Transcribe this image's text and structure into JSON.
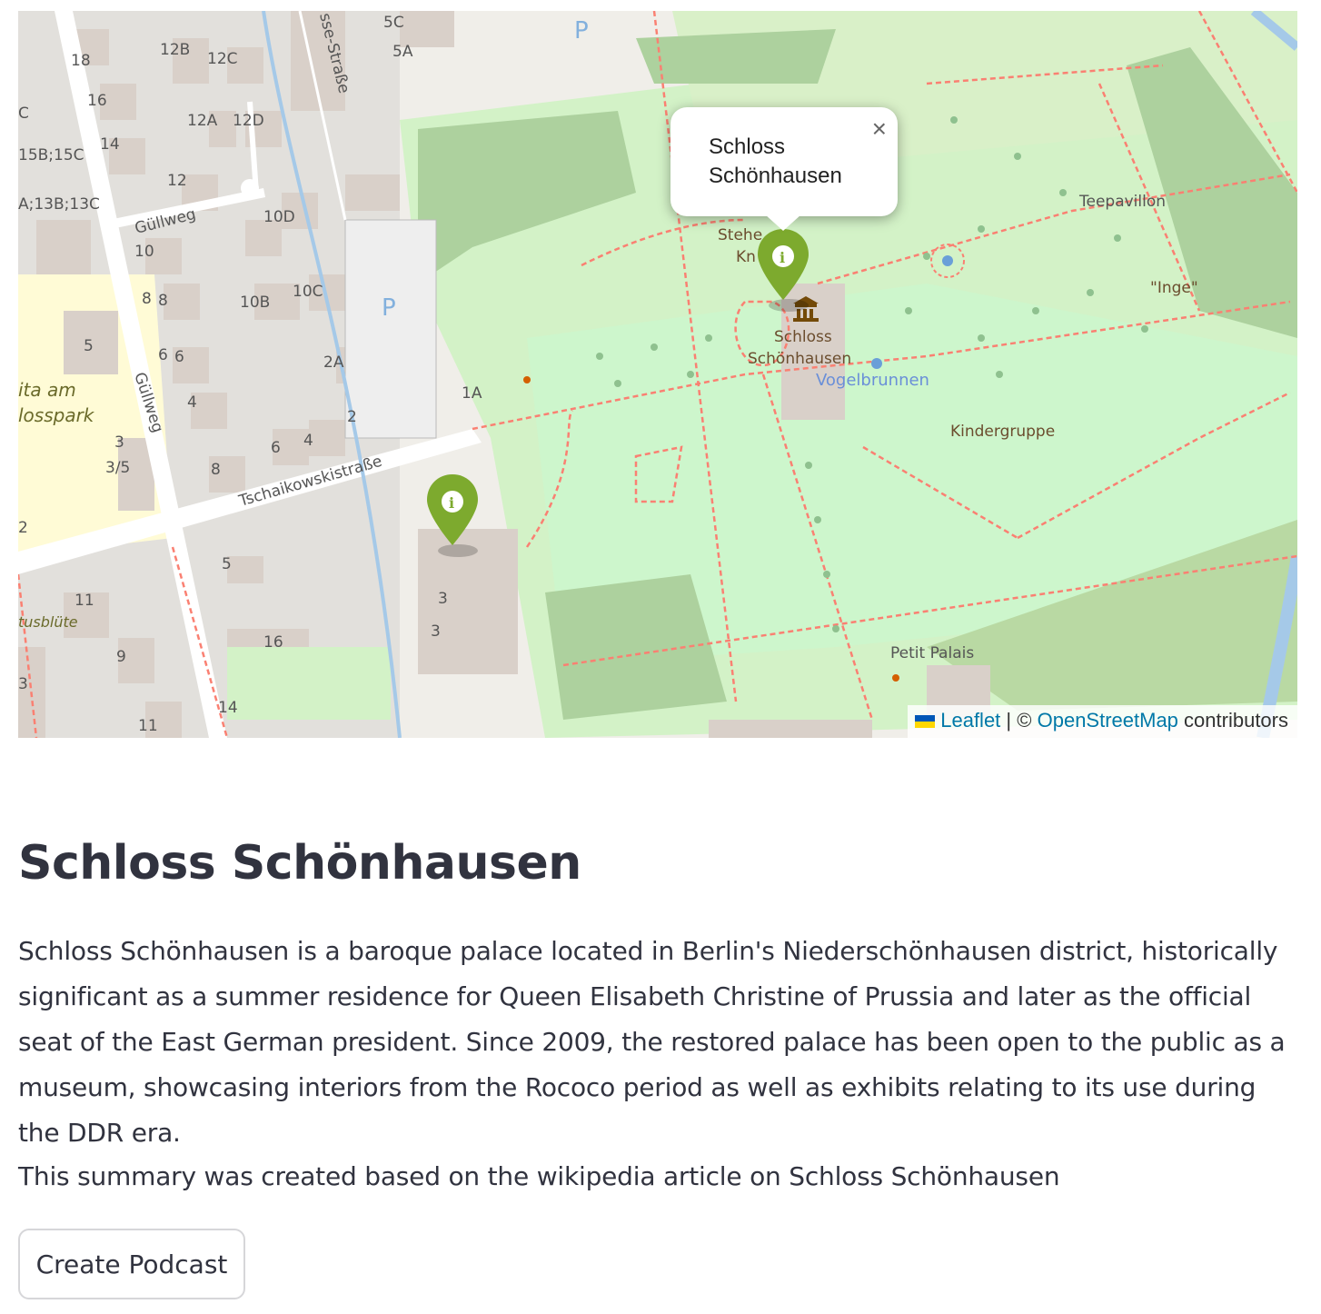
{
  "map": {
    "street_labels": [
      "Güllweg",
      "Güllweg",
      "Tschaikowskistraße",
      "sse-Straße"
    ],
    "place_labels": [
      "Teepavillon",
      "\"Inge\"",
      "Schloss",
      "Schönhausen",
      "Vogelbrunnen",
      "Kindergruppe",
      "Petit Palais",
      "Stehe",
      "Kn",
      "ita am",
      "losspark",
      "tusblüte"
    ],
    "house_numbers": [
      "18",
      "16",
      "12B",
      "12C",
      "12A",
      "12D",
      "14",
      "12",
      "10D",
      "10",
      "8",
      "8",
      "10B",
      "10C",
      "6",
      "6",
      "2A",
      "4",
      "2",
      "4",
      "6",
      "8",
      "3",
      "3/5",
      "5",
      "1A",
      "5",
      "11",
      "9",
      "16",
      "14",
      "11",
      "3",
      "3",
      "5C",
      "5A",
      "15B;15C",
      "A;13B;13C",
      "C",
      "2",
      "3"
    ],
    "parking_label": "P",
    "popup": {
      "title_line1": "Schloss",
      "title_line2": "Schönhausen",
      "close_label": "×"
    },
    "attribution": {
      "leaflet": "Leaflet",
      "separator": "|",
      "copyright": "©",
      "osm": "OpenStreetMap",
      "contributors": "contributors"
    }
  },
  "content": {
    "title": "Schloss Schönhausen",
    "summary": "Schloss Schönhausen is a baroque palace located in Berlin's Niederschönhausen district, historically significant as a summer residence for Queen Elisabeth Christine of Prussia and later as the official seat of the East German president. Since 2009, the restored palace has been open to the public as a museum, showcasing interiors from the Rococo period as well as exhibits relating to its use during the DDR era.",
    "source_note": "This summary was created based on the wikipedia article on Schloss Schönhausen",
    "button_label": "Create Podcast"
  },
  "colors": {
    "marker": "#7daa2e",
    "park": "#c8facc",
    "path": "#fa8072",
    "text": "#31333f",
    "link": "#0078a8"
  }
}
